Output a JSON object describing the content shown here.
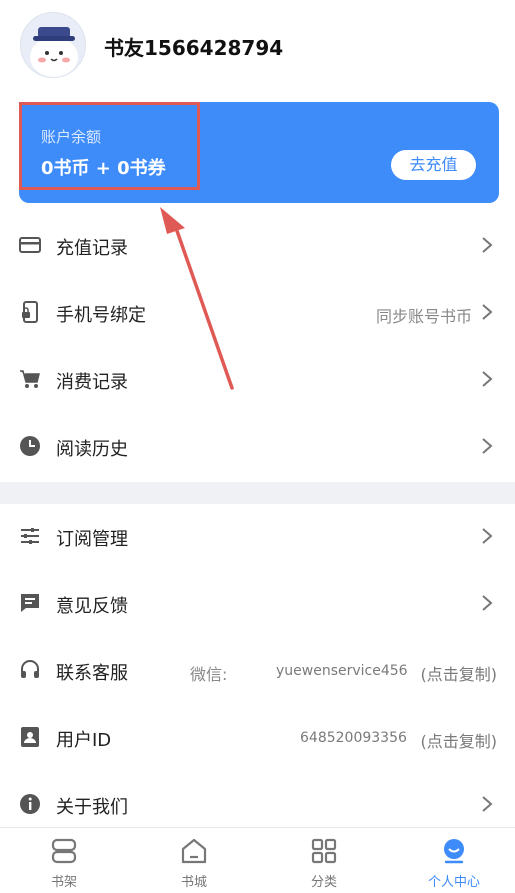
{
  "profile": {
    "username": "书友1566428794"
  },
  "balance": {
    "label": "账户余额",
    "value": "0书币 + 0书券",
    "recharge_label": "去充值"
  },
  "menu": {
    "recharge_record": "充值记录",
    "phone_bind": "手机号绑定",
    "phone_bind_hint": "同步账号书币",
    "consume_record": "消费记录",
    "read_history": "阅读历史",
    "subscription": "订阅管理",
    "feedback": "意见反馈",
    "contact": "联系客服",
    "contact_wechat_label": "微信:",
    "contact_wechat_id": "yuewenservice456",
    "copy_hint": "(点击复制)",
    "user_id_label": "用户ID",
    "user_id_value": "648520093356",
    "about": "关于我们"
  },
  "tabs": {
    "bookshelf": "书架",
    "bookstore": "书城",
    "category": "分类",
    "profile": "个人中心"
  },
  "colors": {
    "accent": "#3e8bfa",
    "annotation": "#e05a55"
  },
  "icons": [
    "card-icon",
    "phone-lock-icon",
    "cart-icon",
    "clock-icon",
    "sliders-icon",
    "feedback-icon",
    "headset-icon",
    "id-card-icon",
    "info-icon",
    "chevron-right-icon"
  ]
}
